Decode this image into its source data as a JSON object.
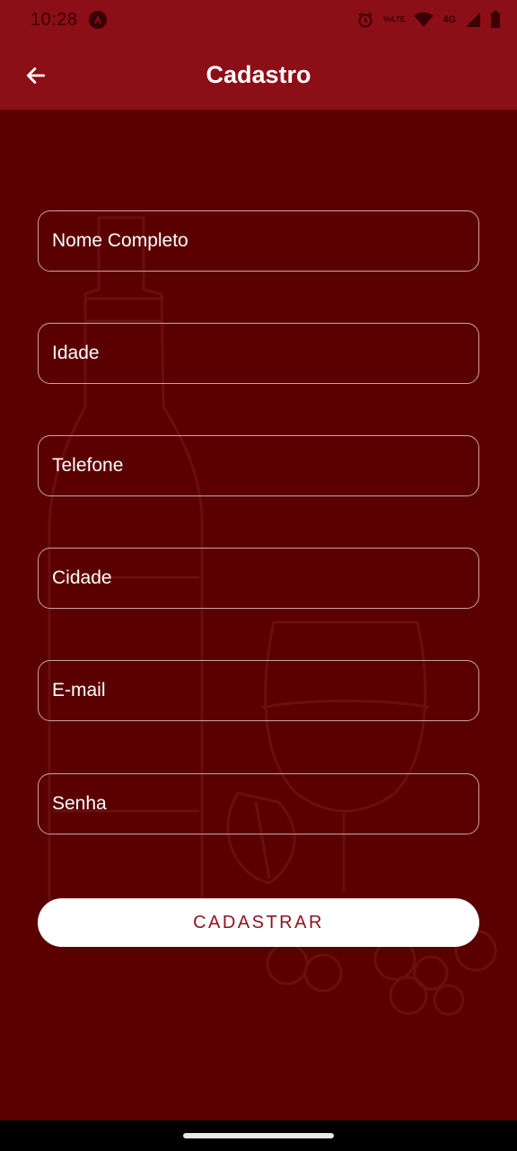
{
  "status_bar": {
    "time": "10:28",
    "lte_label": "VoLTE",
    "network_label": "4G"
  },
  "app_bar": {
    "title": "Cadastro"
  },
  "form": {
    "fields": [
      {
        "placeholder": "Nome Completo"
      },
      {
        "placeholder": "Idade"
      },
      {
        "placeholder": "Telefone"
      },
      {
        "placeholder": "Cidade"
      },
      {
        "placeholder": "E-mail"
      },
      {
        "placeholder": "Senha"
      }
    ],
    "submit_label": "CADASTRAR"
  },
  "colors": {
    "app_bar": "#8c0e17",
    "background": "#5a0000",
    "button_text": "#8c1520"
  }
}
